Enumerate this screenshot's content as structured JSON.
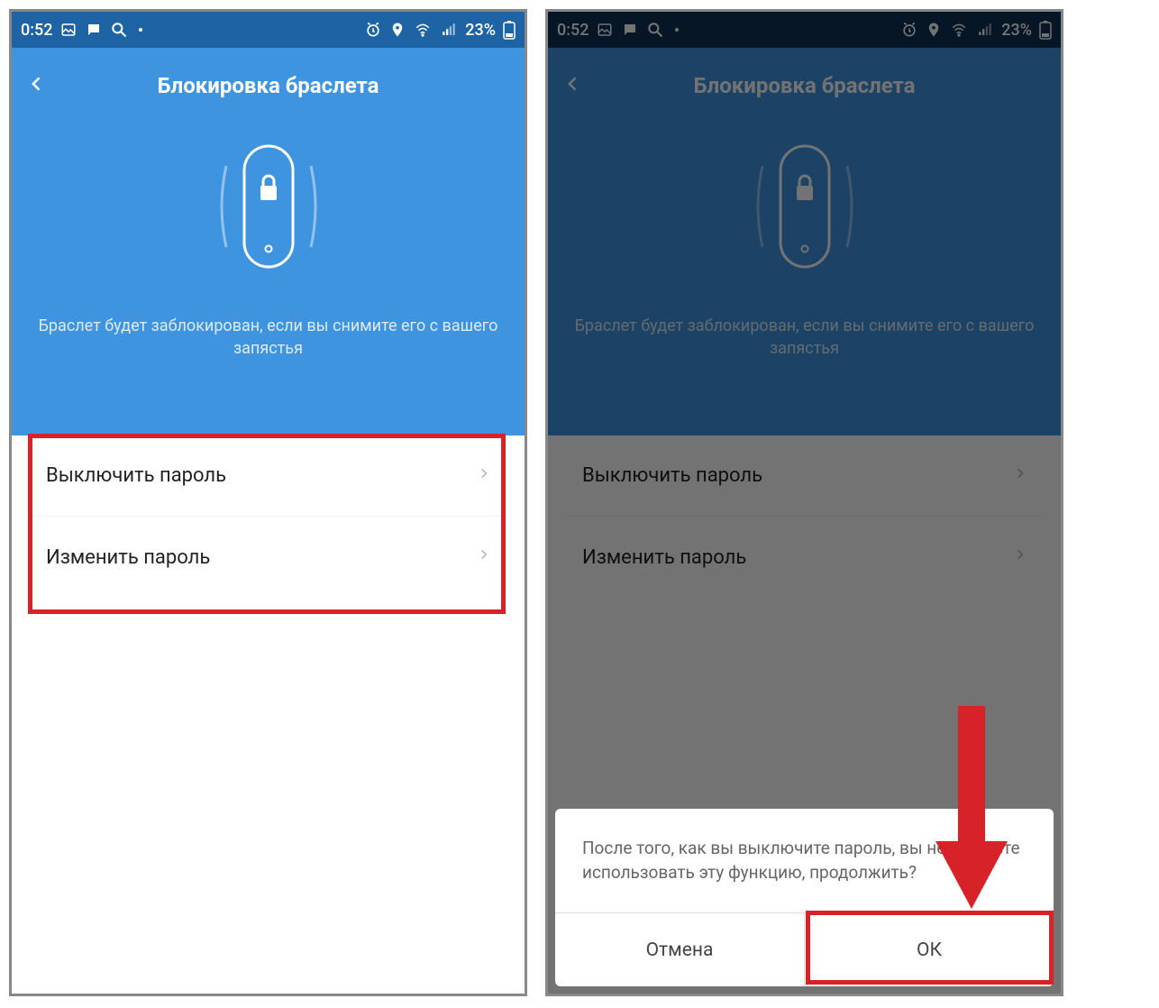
{
  "statusbar": {
    "time": "0:52",
    "battery_text": "23%",
    "signal_label": "signal"
  },
  "header": {
    "title": "Блокировка браслета",
    "description": "Браслет будет заблокирован, если вы снимите его с вашего запястья"
  },
  "list": {
    "items": [
      {
        "label": "Выключить пароль"
      },
      {
        "label": "Изменить пароль"
      }
    ]
  },
  "dialog": {
    "message": "После того, как вы выключите пароль, вы не сможете использовать эту функцию, продолжить?",
    "cancel_label": "Отмена",
    "ok_label": "ОК"
  },
  "colors": {
    "header_bg": "#3e94df",
    "statusbar_bg": "#1e63a3",
    "annotation": "#d8222a"
  }
}
